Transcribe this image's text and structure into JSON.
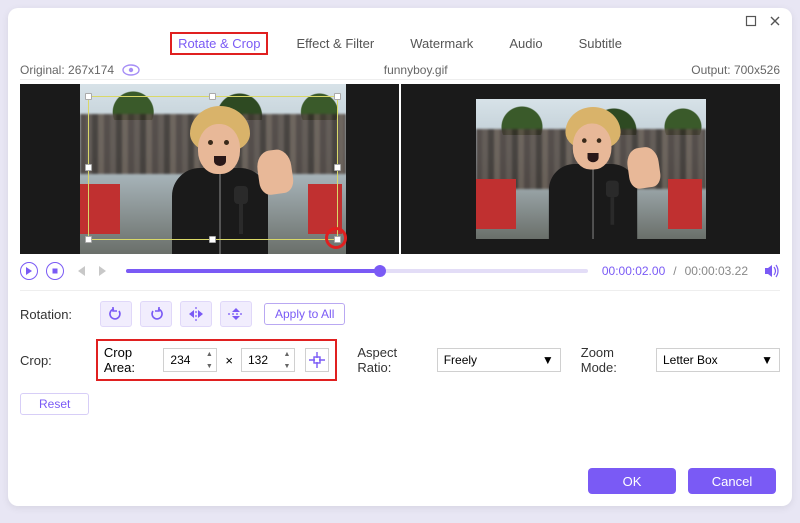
{
  "window": {
    "maximize_title": "Maximize",
    "close_title": "Close"
  },
  "tabs": {
    "rotate_crop": "Rotate & Crop",
    "effect_filter": "Effect & Filter",
    "watermark": "Watermark",
    "audio": "Audio",
    "subtitle": "Subtitle"
  },
  "infobar": {
    "original_label": "Original:",
    "original_size": "267x174",
    "filename": "funnyboy.gif",
    "output_label": "Output:",
    "output_size": "700x526"
  },
  "transport": {
    "current_time": "00:00:02.00",
    "separator": "/",
    "duration": "00:00:03.22",
    "progress_percent": 55
  },
  "rotation": {
    "label": "Rotation:",
    "btn_ccw": "Rotate Left",
    "btn_cw": "Rotate Right",
    "btn_flip_h": "Flip Horizontal",
    "btn_flip_v": "Flip Vertical",
    "apply_all": "Apply to All"
  },
  "crop": {
    "label": "Crop:",
    "area_label": "Crop Area:",
    "width": "234",
    "height": "132",
    "aspect_label": "Aspect Ratio:",
    "aspect_value": "Freely",
    "zoom_label": "Zoom Mode:",
    "zoom_value": "Letter Box",
    "reset": "Reset",
    "center_title": "Center"
  },
  "footer": {
    "ok": "OK",
    "cancel": "Cancel"
  }
}
